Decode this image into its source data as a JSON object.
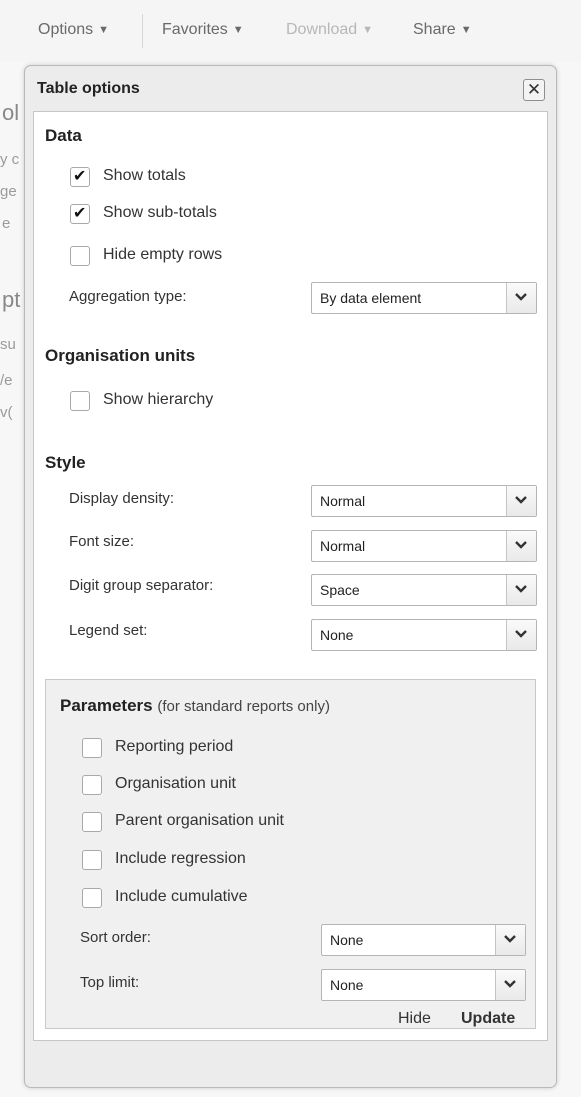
{
  "toolbar": {
    "options": "Options",
    "favorites": "Favorites",
    "download": "Download",
    "share": "Share"
  },
  "background": {
    "frag1": "ol",
    "frag2": "y c",
    "frag3": "ge",
    "frag4": "e",
    "frag5": "pt",
    "frag6": "su",
    "frag7": "/e",
    "frag8": "v("
  },
  "window": {
    "title": "Table options",
    "close_label": "✕"
  },
  "data_section": {
    "title": "Data",
    "show_totals": {
      "label": "Show totals",
      "checked": true
    },
    "show_subtotals": {
      "label": "Show sub-totals",
      "checked": true
    },
    "hide_empty_rows": {
      "label": "Hide empty rows",
      "checked": false
    },
    "aggregation_label": "Aggregation type:",
    "aggregation_value": "By data element"
  },
  "org_section": {
    "title": "Organisation units",
    "show_hierarchy": {
      "label": "Show hierarchy",
      "checked": false
    }
  },
  "style_section": {
    "title": "Style",
    "display_density_label": "Display density:",
    "display_density_value": "Normal",
    "font_size_label": "Font size:",
    "font_size_value": "Normal",
    "digit_sep_label": "Digit group separator:",
    "digit_sep_value": "Space",
    "legend_set_label": "Legend set:",
    "legend_set_value": "None"
  },
  "params_section": {
    "title": "Parameters",
    "note": "(for standard reports only)",
    "reporting_period": {
      "label": "Reporting period",
      "checked": false
    },
    "organisation_unit": {
      "label": "Organisation unit",
      "checked": false
    },
    "parent_org_unit": {
      "label": "Parent organisation unit",
      "checked": false
    },
    "include_regression": {
      "label": "Include regression",
      "checked": false
    },
    "include_cumulative": {
      "label": "Include cumulative",
      "checked": false
    },
    "sort_order_label": "Sort order:",
    "sort_order_value": "None",
    "top_limit_label": "Top limit:",
    "top_limit_value": "None"
  },
  "footer": {
    "hide": "Hide",
    "update": "Update"
  },
  "colors": {
    "background": "#f7f7f7",
    "window": "#ececec",
    "panel": "#ffffff",
    "params_bg": "#f0f0f0",
    "disabled_text": "#b7b7b7"
  }
}
